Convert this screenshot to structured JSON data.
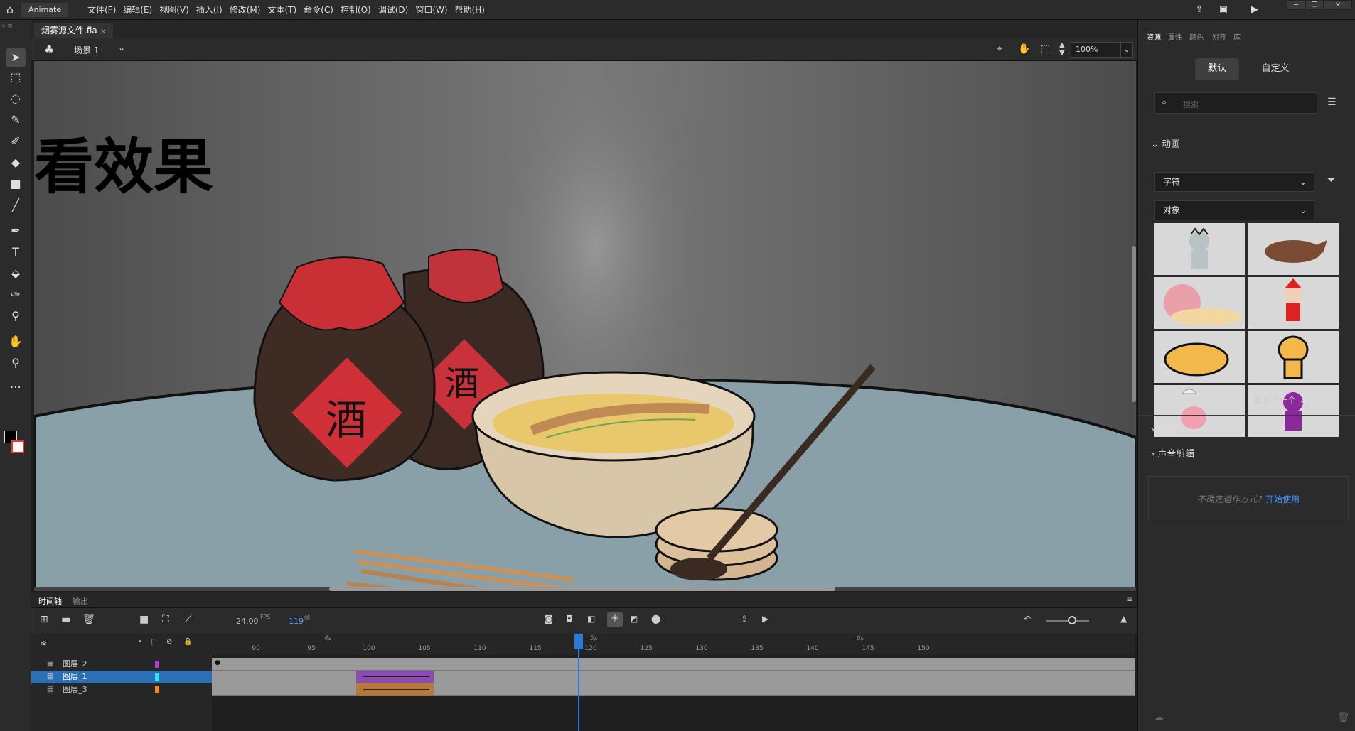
{
  "app": {
    "name": "Animate",
    "home_icon": "home-icon"
  },
  "menu": [
    "文件(F)",
    "编辑(E)",
    "视图(V)",
    "插入(I)",
    "修改(M)",
    "文本(T)",
    "命令(C)",
    "控制(O)",
    "调试(D)",
    "窗口(W)",
    "帮助(H)"
  ],
  "document": {
    "tab_title": "烟雾源文件.fla",
    "scene": "场景 1",
    "zoom": "100%"
  },
  "stage": {
    "overlay_text": "看效果"
  },
  "timeline": {
    "tabs": [
      "时间轴",
      "输出"
    ],
    "fps": "24.00",
    "fps_unit": "FPS",
    "frame": "119",
    "frame_unit": "帧",
    "time_labels": [
      "4s",
      "5s",
      "6s"
    ],
    "ruler": [
      "90",
      "95",
      "100",
      "105",
      "110",
      "115",
      "120",
      "125",
      "130",
      "135",
      "140",
      "145",
      "150"
    ],
    "layers": [
      {
        "name": "图层_2",
        "color": "#b43ad6",
        "selected": false
      },
      {
        "name": "图层_1",
        "color": "#2fe6f0",
        "selected": true
      },
      {
        "name": "图层_3",
        "color": "#f08a1e",
        "selected": false
      }
    ],
    "tween_colors": {
      "layer1": "#8a4bb3",
      "layer3": "#b8783a"
    },
    "playhead_frame": 119
  },
  "panel": {
    "tabs": [
      "资源",
      "属性",
      "颜色",
      "对齐",
      "库"
    ],
    "toggle": [
      "默认",
      "自定义"
    ],
    "search_placeholder": "搜索",
    "section_animation": "动画",
    "dropdown1": "字符",
    "dropdown2": "对象",
    "show_next": "显示下一个",
    "section_static": "静态",
    "section_sound": "声音剪辑",
    "hint_text": "不确定运作方式？",
    "hint_link": "开始使用"
  }
}
